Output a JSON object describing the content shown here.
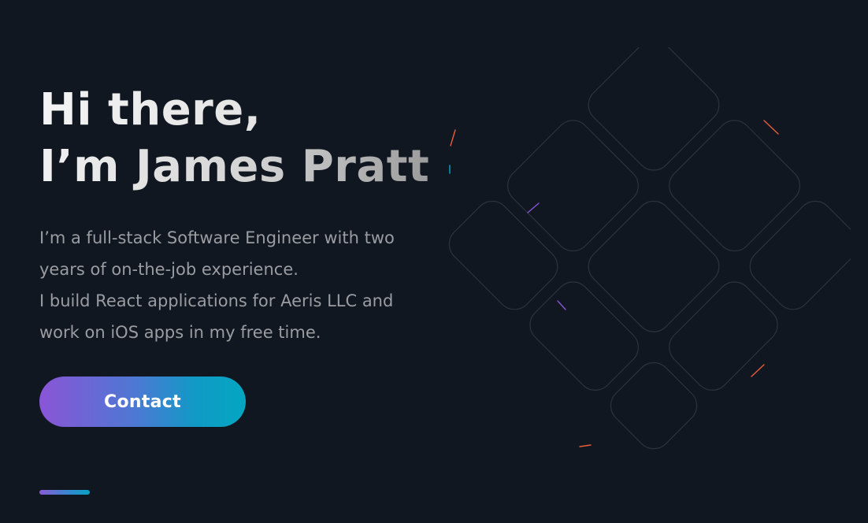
{
  "hero": {
    "greeting_line1": "Hi there,",
    "greeting_line2": "I’m James Pratt",
    "bio_lines": [
      "I’m a full-stack Software Engineer with two",
      "years of on-the-job experience.",
      "I build React applications for Aeris LLC and",
      "work on iOS apps in my free time."
    ],
    "contact_label": "Contact"
  },
  "colors": {
    "background": "#111720",
    "accent_purple": "#8a55d6",
    "accent_cyan": "#02a7c1",
    "text_primary": "#ececec",
    "text_secondary": "#9a9ca2"
  },
  "decoration": {
    "icon": "diamond-grid-pattern-icon",
    "scroll_indicator_icon": "gradient-bar-icon"
  }
}
